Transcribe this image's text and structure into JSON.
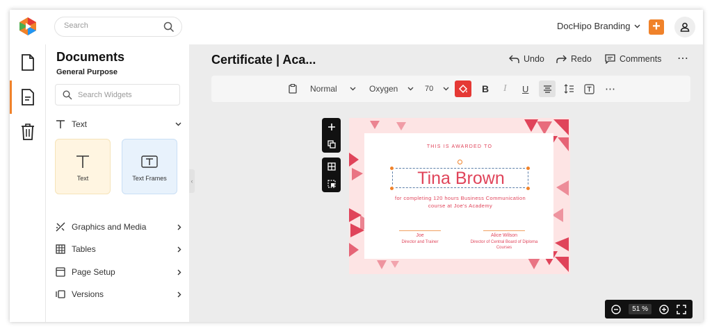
{
  "topbar": {
    "search_placeholder": "Search",
    "brand_label": "DocHipo Branding",
    "add_label": "+"
  },
  "rail": {
    "items": [
      {
        "name": "documents",
        "icon": "document-icon"
      },
      {
        "name": "page",
        "icon": "page-list-icon",
        "active": true
      },
      {
        "name": "trash",
        "icon": "trash-icon"
      }
    ]
  },
  "panel": {
    "title": "Documents",
    "subtitle": "General Purpose",
    "search_placeholder": "Search Widgets",
    "text_section": "Text",
    "cards": [
      {
        "label": "Text",
        "icon": "text-icon"
      },
      {
        "label": "Text Frames",
        "icon": "text-frame-icon"
      }
    ],
    "sections": [
      {
        "label": "Graphics and Media",
        "icon": "graphics-icon"
      },
      {
        "label": "Tables",
        "icon": "table-icon"
      },
      {
        "label": "Page Setup",
        "icon": "page-setup-icon"
      },
      {
        "label": "Versions",
        "icon": "versions-icon"
      }
    ]
  },
  "document": {
    "title": "Certificate | Aca...",
    "undo": "Undo",
    "redo": "Redo",
    "comments": "Comments"
  },
  "toolbar": {
    "style": "Normal",
    "font": "Oxygen",
    "size": "70"
  },
  "certificate": {
    "awarded_to": "THIS IS AWARDED TO",
    "name": "Tina Brown",
    "description": "for completing 120 hours Business Communication course at Joe's Academy",
    "signer1_name": "Joe",
    "signer1_title": "Director and Trainer",
    "signer2_name": "Alice Wilson",
    "signer2_title": "Director of Central Board of Diploma Courses"
  },
  "zoom": {
    "value": "51 %"
  },
  "colors": {
    "accent": "#f0822a",
    "cert_pink": "#e0445a",
    "cert_bg": "#fde4e4"
  }
}
